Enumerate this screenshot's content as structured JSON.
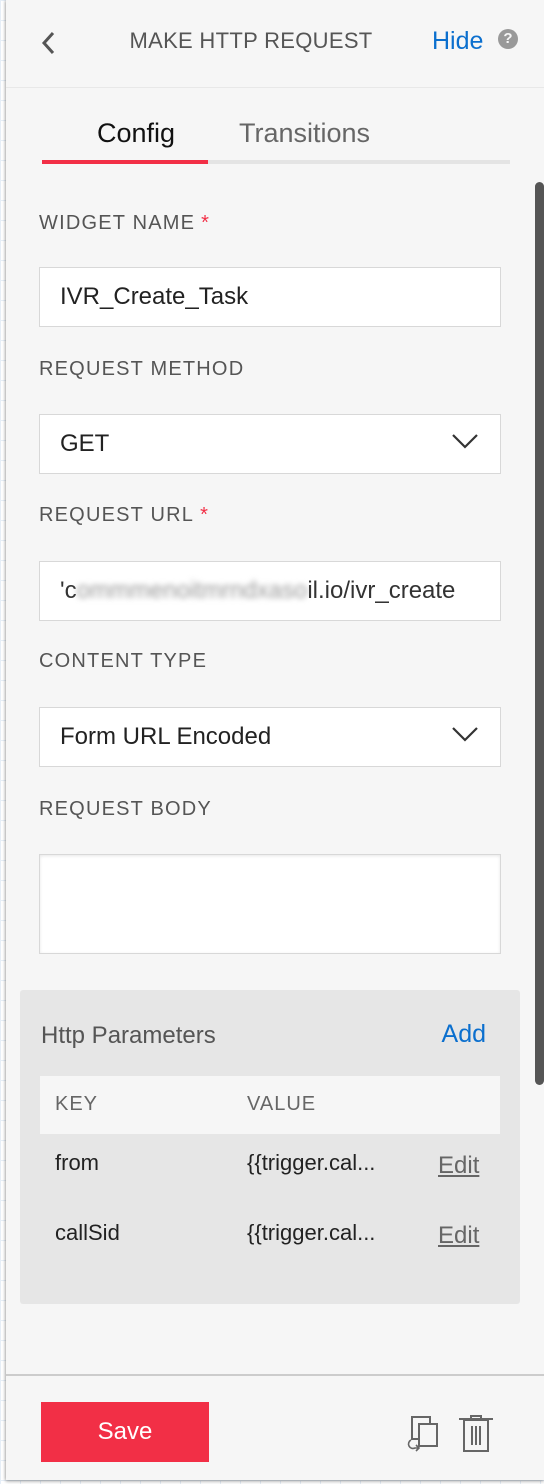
{
  "header": {
    "title": "MAKE HTTP REQUEST",
    "hide_label": "Hide",
    "help_icon": "question-circle-icon",
    "back_icon": "chevron-left-icon"
  },
  "tabs": [
    {
      "label": "Config",
      "active": true
    },
    {
      "label": "Transitions",
      "active": false
    }
  ],
  "form": {
    "widget_name": {
      "label": "WIDGET NAME",
      "required": "*",
      "value": "IVR_Create_Task"
    },
    "request_method": {
      "label": "REQUEST METHOD",
      "value": "GET"
    },
    "request_url": {
      "label": "REQUEST URL",
      "required": "*",
      "value_visible": "il.io/ivr_create",
      "value_prefix": "'c"
    },
    "content_type": {
      "label": "CONTENT TYPE",
      "value": "Form URL Encoded"
    },
    "request_body": {
      "label": "REQUEST BODY",
      "value": ""
    }
  },
  "http_parameters": {
    "title": "Http Parameters",
    "add_label": "Add",
    "columns": [
      "KEY",
      "VALUE"
    ],
    "rows": [
      {
        "key": "from",
        "value": "{{trigger.cal...",
        "action": "Edit"
      },
      {
        "key": "callSid",
        "value": "{{trigger.cal...",
        "action": "Edit"
      }
    ]
  },
  "footer": {
    "save_label": "Save",
    "duplicate_icon": "duplicate-icon",
    "delete_icon": "trash-icon"
  },
  "colors": {
    "accent": "#f22f46",
    "link": "#0b6fce"
  }
}
